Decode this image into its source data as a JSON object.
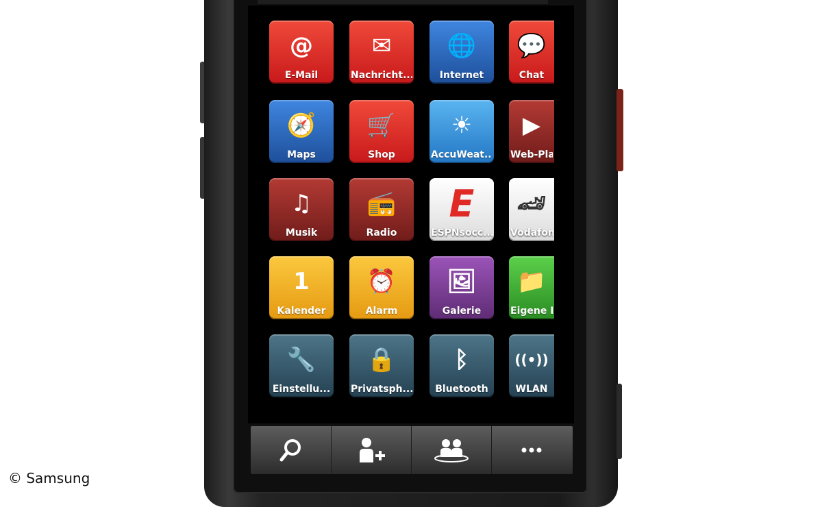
{
  "apps": [
    {
      "label": "E-Mail",
      "icon": "at-icon",
      "color": "#e02a26"
    },
    {
      "label": "Nachricht...",
      "icon": "envelope-icon",
      "color": "#e02a26"
    },
    {
      "label": "Internet",
      "icon": "globe-icon",
      "color": "#2f6cc4"
    },
    {
      "label": "Chat",
      "icon": "speech-bubble-icon",
      "color": "#e02a26"
    },
    {
      "label": "Maps",
      "icon": "compass-icon",
      "color": "#2f6cc4"
    },
    {
      "label": "Shop",
      "icon": "shopping-cart-icon",
      "color": "#e02a26"
    },
    {
      "label": "AccuWeat...",
      "icon": "sun-icon",
      "color": "#3b94dc"
    },
    {
      "label": "Web-Pla...",
      "icon": "play-icon",
      "color": "#a22a24"
    },
    {
      "label": "Musik",
      "icon": "music-note-icon",
      "color": "#a22a24"
    },
    {
      "label": "Radio",
      "icon": "radio-icon",
      "color": "#a22a24"
    },
    {
      "label": "ESPNsocc...",
      "icon": "espn-logo-icon",
      "color": "#ffffff"
    },
    {
      "label": "Vodafone",
      "icon": "race-car-icon",
      "color": "#ffffff"
    },
    {
      "label": "Kalender",
      "icon": "calendar-icon",
      "color": "#f2b12a"
    },
    {
      "label": "Alarm",
      "icon": "alarm-clock-icon",
      "color": "#f2b12a"
    },
    {
      "label": "Galerie",
      "icon": "picture-icon",
      "color": "#7a3c96"
    },
    {
      "label": "Eigene D...",
      "icon": "folder-icon",
      "color": "#3fb234"
    },
    {
      "label": "Einstellu...",
      "icon": "tools-icon",
      "color": "#36596b"
    },
    {
      "label": "Privatsph...",
      "icon": "lock-user-icon",
      "color": "#36596b"
    },
    {
      "label": "Bluetooth",
      "icon": "bluetooth-icon",
      "color": "#36596b"
    },
    {
      "label": "WLAN",
      "icon": "wifi-icon",
      "color": "#36596b"
    }
  ],
  "dock": [
    {
      "icon": "search-icon",
      "glyph": "⚲"
    },
    {
      "icon": "add-contact-icon",
      "glyph": "👤+"
    },
    {
      "icon": "contacts-group-icon",
      "glyph": "👥"
    },
    {
      "icon": "more-icon",
      "glyph": "•••"
    }
  ],
  "watermark": "© Samsung"
}
